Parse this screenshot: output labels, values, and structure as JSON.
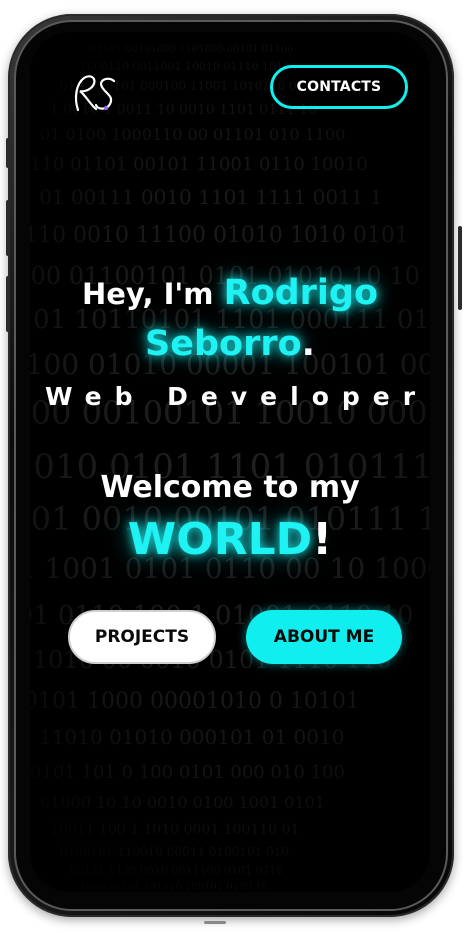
{
  "header": {
    "logo_text": "RS",
    "contacts_label": "CONTACTS"
  },
  "hero": {
    "greeting_prefix": "Hey, I'm ",
    "first_name": "Rodrigo",
    "last_name": "Seborro",
    "name_period": ".",
    "role": "Web Developer",
    "welcome_text": "Welcome to my",
    "world_text": "WORLD",
    "world_exclaim": "!"
  },
  "actions": {
    "projects_label": "PROJECTS",
    "about_label": "ABOUT ME"
  },
  "colors": {
    "accent": "#1ef2f2",
    "background": "#000000",
    "button_light": "#ffffff"
  }
}
